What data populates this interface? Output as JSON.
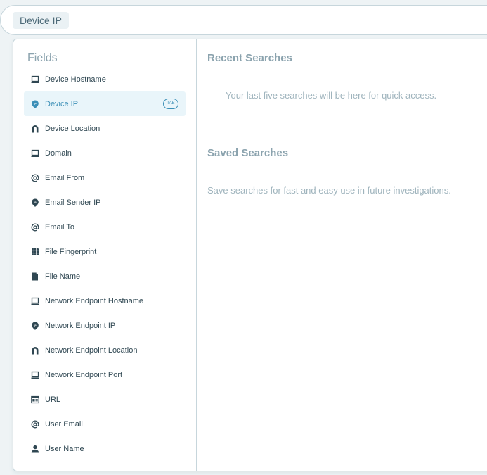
{
  "search": {
    "chip_label": "Device IP"
  },
  "fields": {
    "title": "Fields",
    "tab_badge": "TAB",
    "items": [
      {
        "label": "Device Hostname",
        "icon": "monitor-icon"
      },
      {
        "label": "Device IP",
        "icon": "ip-pin-icon",
        "active": true
      },
      {
        "label": "Device Location",
        "icon": "magnet-icon"
      },
      {
        "label": "Domain",
        "icon": "monitor-icon"
      },
      {
        "label": "Email From",
        "icon": "at-icon"
      },
      {
        "label": "Email Sender IP",
        "icon": "ip-pin-icon"
      },
      {
        "label": "Email To",
        "icon": "at-icon"
      },
      {
        "label": "File Fingerprint",
        "icon": "fingerprint-grid-icon"
      },
      {
        "label": "File Name",
        "icon": "file-icon"
      },
      {
        "label": "Network Endpoint Hostname",
        "icon": "monitor-icon"
      },
      {
        "label": "Network Endpoint IP",
        "icon": "ip-pin-icon"
      },
      {
        "label": "Network Endpoint Location",
        "icon": "magnet-icon"
      },
      {
        "label": "Network Endpoint Port",
        "icon": "monitor-icon"
      },
      {
        "label": "URL",
        "icon": "browser-icon"
      },
      {
        "label": "User Email",
        "icon": "at-icon"
      },
      {
        "label": "User Name",
        "icon": "user-icon"
      }
    ]
  },
  "recent": {
    "title": "Recent Searches",
    "empty_text": "Your last five searches will be here for quick access."
  },
  "saved": {
    "title": "Saved Searches",
    "empty_text": "Save searches for fast and easy use in future investigations."
  },
  "colors": {
    "accent": "#3b8fb7",
    "active_bg": "#e9f5fa",
    "icon": "#2f4752",
    "muted_text": "#9fb4bd"
  }
}
